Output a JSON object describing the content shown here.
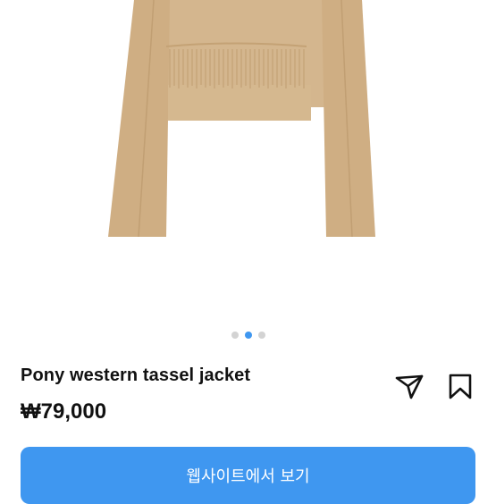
{
  "product": {
    "image_icon": "product-photo",
    "carousel": {
      "count": 3,
      "active_index": 1
    },
    "name": "Pony western tassel jacket",
    "price": "₩79,000"
  },
  "actions": {
    "share_icon": "send-icon",
    "save_icon": "bookmark-icon",
    "cta_label": "웹사이트에서 보기"
  },
  "colors": {
    "accent": "#3f97f0",
    "jacket": "#d2b48c",
    "dot_inactive": "#d3d3d3"
  }
}
